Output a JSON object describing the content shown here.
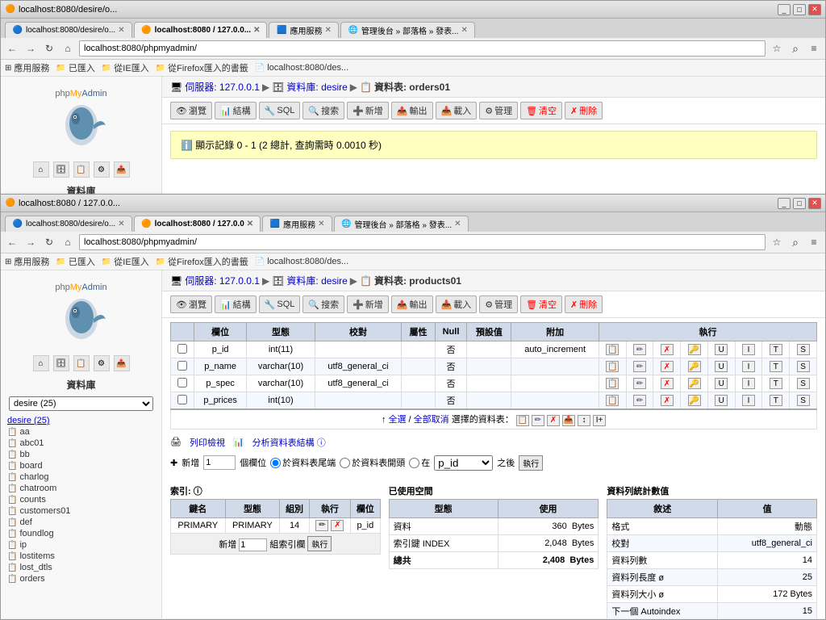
{
  "windows": {
    "back": {
      "title": "localhost:8080/desire/o...",
      "tabs": [
        {
          "label": "localhost:8080/desire/o...",
          "active": false,
          "favicon": "🔵"
        },
        {
          "label": "localhost:8080 / 127.0.0...",
          "active": true,
          "favicon": "🟠"
        },
        {
          "label": "應用服務",
          "active": false,
          "favicon": "🟦"
        },
        {
          "label": "管理後台 » 部落格 » 發表...",
          "active": false,
          "favicon": "🌐"
        }
      ],
      "address": "localhost:8080/phpmyadmin/",
      "bookmarks": [
        "應用服務",
        "已匯入",
        "從IE匯入",
        "從Firefox匯入的書籤",
        "localhost:8080/des..."
      ],
      "breadcrumb": {
        "server": "伺服器: 127.0.0.1",
        "db": "資料庫: desire",
        "table": "資料表: orders01"
      },
      "toolbar": [
        "瀏覽",
        "結構",
        "SQL",
        "搜索",
        "新增",
        "輸出",
        "載入",
        "管理",
        "清空",
        "刪除"
      ],
      "info_msg": "顯示記錄 0 - 1 (2 總計, 查詢需時 0.0010 秒)"
    },
    "front": {
      "title": "localhost:8080 / 127.0.0...",
      "tabs": [
        {
          "label": "localhost:8080/desire/o...",
          "active": false,
          "favicon": "🔵"
        },
        {
          "label": "localhost:8080 / 127.0.0",
          "active": true,
          "favicon": "🟠"
        },
        {
          "label": "應用服務",
          "active": false,
          "favicon": "🟦"
        },
        {
          "label": "管理後台 » 部落格 » 發表...",
          "active": false,
          "favicon": "🌐"
        }
      ],
      "address": "localhost:8080/phpmyadmin/",
      "bookmarks": [
        "應用服務",
        "已匯入",
        "從IE匯入",
        "從Firefox匯入的書籤",
        "localhost:8080/des..."
      ],
      "breadcrumb": {
        "server": "伺服器: 127.0.0.1",
        "db": "資料庫: desire",
        "table": "資料表: products01"
      },
      "toolbar": [
        "瀏覽",
        "結構",
        "SQL",
        "搜索",
        "新增",
        "輸出",
        "載入",
        "管理",
        "清空",
        "刪除"
      ],
      "sidebar": {
        "db_label": "資料庫",
        "db_select": "desire (25)",
        "db_link": "desire (25)",
        "tree_items": [
          {
            "name": "aa",
            "icon": "📄"
          },
          {
            "name": "abc01",
            "icon": "📄"
          },
          {
            "name": "bb",
            "icon": "📄"
          },
          {
            "name": "board",
            "icon": "📄"
          },
          {
            "name": "charlog",
            "icon": "📄"
          },
          {
            "name": "chatroom",
            "icon": "📄"
          },
          {
            "name": "counts",
            "icon": "📄"
          },
          {
            "name": "customers01",
            "icon": "📄"
          },
          {
            "name": "def",
            "icon": "📄"
          },
          {
            "name": "foundlog",
            "icon": "📄"
          },
          {
            "name": "ip",
            "icon": "📄"
          },
          {
            "name": "lostitems",
            "icon": "📄"
          },
          {
            "name": "lost_dtls",
            "icon": "📄"
          },
          {
            "name": "orders",
            "icon": "📄"
          }
        ]
      },
      "table": {
        "columns": [
          "欄位",
          "型態",
          "校對",
          "屬性",
          "Null",
          "預設值",
          "附加",
          "執行"
        ],
        "rows": [
          {
            "name": "p_id",
            "type": "int(11)",
            "collation": "",
            "attribute": "",
            "null": "否",
            "default": "",
            "extra": "auto_increment"
          },
          {
            "name": "p_name",
            "type": "varchar(10)",
            "collation": "utf8_general_ci",
            "attribute": "",
            "null": "否",
            "default": "",
            "extra": ""
          },
          {
            "name": "p_spec",
            "type": "varchar(10)",
            "collation": "utf8_general_ci",
            "attribute": "",
            "null": "否",
            "default": "",
            "extra": ""
          },
          {
            "name": "p_prices",
            "type": "int(10)",
            "collation": "",
            "attribute": "",
            "null": "否",
            "default": "",
            "extra": ""
          }
        ]
      },
      "print_row": {
        "print_link": "列印檢視",
        "analyze_link": "分析資料表結構 ⓘ"
      },
      "new_field": {
        "label_new": "新增",
        "input_value": "1",
        "label_cols": "個欄位",
        "radio1": "於資料表尾端",
        "radio2": "於資料表開頭",
        "radio3": "在",
        "select_col": "p_id",
        "label_after": "之後",
        "exec_btn": "執行"
      },
      "index_section": {
        "title": "索引: ⓘ",
        "columns": [
          "鍵名",
          "型態",
          "組別",
          "執行",
          "欄位"
        ],
        "rows": [
          {
            "keyname": "PRIMARY",
            "type": "PRIMARY",
            "group": "14",
            "field": "p_id"
          }
        ],
        "add_row": {
          "label_new": "新增",
          "input_value": "1",
          "label_index": "組索引欄",
          "exec_btn": "執行"
        }
      },
      "space_section": {
        "title": "已使用空間",
        "columns": [
          "型態",
          "使用"
        ],
        "rows": [
          {
            "type": "資料",
            "value": "360",
            "unit": "Bytes"
          },
          {
            "type": "索引鍵 INDEX",
            "value": "2,048",
            "unit": "Bytes"
          },
          {
            "type": "總共",
            "value": "2,408",
            "unit": "Bytes"
          }
        ]
      },
      "stats_section": {
        "title": "資料列統計數值",
        "columns": [
          "敘述",
          "值"
        ],
        "rows": [
          {
            "desc": "格式",
            "value": "動態"
          },
          {
            "desc": "校對",
            "value": "utf8_general_ci"
          },
          {
            "desc": "資料列數",
            "value": "14"
          },
          {
            "desc": "資料列長度 ø",
            "value": "25"
          },
          {
            "desc": "資料列大小 ø",
            "value": "172 Bytes"
          },
          {
            "desc": "下一個 Autoindex",
            "value": "15"
          }
        ]
      }
    }
  },
  "icons": {
    "back": "←",
    "forward": "→",
    "reload": "↻",
    "home": "⌂",
    "star": "☆",
    "menu": "≡",
    "close": "✕",
    "minimize": "_",
    "maximize": "□",
    "folder": "📁",
    "table": "📋",
    "db_icon": "🗄️",
    "server_icon": "🖥️",
    "pencil": "✏",
    "redx": "✗",
    "copy": "⧉",
    "move": "↕",
    "info": "ℹ"
  }
}
